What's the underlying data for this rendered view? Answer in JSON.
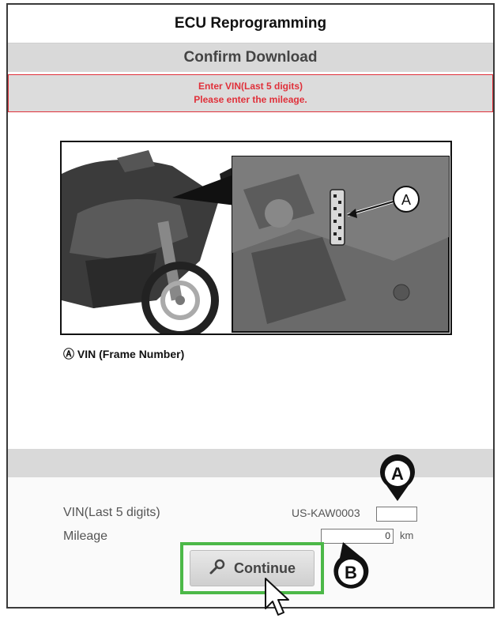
{
  "window": {
    "title": "ECU Reprogramming"
  },
  "header": {
    "subtitle": "Confirm Download"
  },
  "alert": {
    "line1": "Enter VIN(Last 5 digits)",
    "line2": "Please enter the mileage."
  },
  "illustration": {
    "callout_letter": "A",
    "caption": "Ⓐ VIN (Frame Number)"
  },
  "form": {
    "vin_label": "VIN(Last 5 digits)",
    "vin_prefix": "US-KAW0003",
    "vin_value": "",
    "mileage_label": "Mileage",
    "mileage_value": "0",
    "mileage_unit": "km"
  },
  "buttons": {
    "continue_label": "Continue"
  },
  "markers": {
    "vin_marker": "A",
    "button_marker": "B"
  },
  "icons": {
    "button_icon": "wrench-icon",
    "pointer": "mouse-cursor-icon",
    "vin_marker": "map-pin-icon",
    "button_marker": "map-pin-icon"
  },
  "colors": {
    "alert_red": "#e0303a",
    "highlight_green": "#4cb848",
    "band_gray": "#d9d9d9"
  }
}
